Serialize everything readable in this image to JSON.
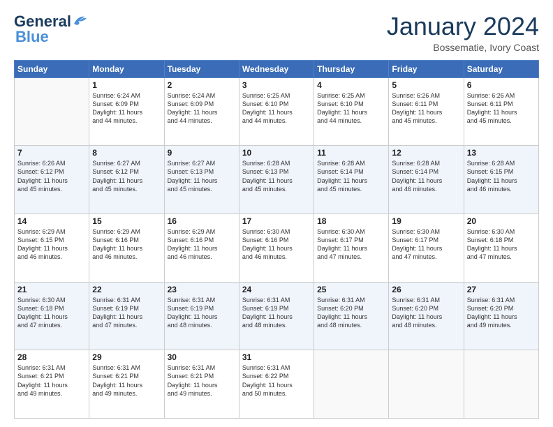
{
  "logo": {
    "line1": "General",
    "line2": "Blue"
  },
  "title": "January 2024",
  "subtitle": "Bossematie, Ivory Coast",
  "headers": [
    "Sunday",
    "Monday",
    "Tuesday",
    "Wednesday",
    "Thursday",
    "Friday",
    "Saturday"
  ],
  "weeks": [
    [
      {
        "day": "",
        "info": ""
      },
      {
        "day": "1",
        "info": "Sunrise: 6:24 AM\nSunset: 6:09 PM\nDaylight: 11 hours\nand 44 minutes."
      },
      {
        "day": "2",
        "info": "Sunrise: 6:24 AM\nSunset: 6:09 PM\nDaylight: 11 hours\nand 44 minutes."
      },
      {
        "day": "3",
        "info": "Sunrise: 6:25 AM\nSunset: 6:10 PM\nDaylight: 11 hours\nand 44 minutes."
      },
      {
        "day": "4",
        "info": "Sunrise: 6:25 AM\nSunset: 6:10 PM\nDaylight: 11 hours\nand 44 minutes."
      },
      {
        "day": "5",
        "info": "Sunrise: 6:26 AM\nSunset: 6:11 PM\nDaylight: 11 hours\nand 45 minutes."
      },
      {
        "day": "6",
        "info": "Sunrise: 6:26 AM\nSunset: 6:11 PM\nDaylight: 11 hours\nand 45 minutes."
      }
    ],
    [
      {
        "day": "7",
        "info": "Sunrise: 6:26 AM\nSunset: 6:12 PM\nDaylight: 11 hours\nand 45 minutes."
      },
      {
        "day": "8",
        "info": "Sunrise: 6:27 AM\nSunset: 6:12 PM\nDaylight: 11 hours\nand 45 minutes."
      },
      {
        "day": "9",
        "info": "Sunrise: 6:27 AM\nSunset: 6:13 PM\nDaylight: 11 hours\nand 45 minutes."
      },
      {
        "day": "10",
        "info": "Sunrise: 6:28 AM\nSunset: 6:13 PM\nDaylight: 11 hours\nand 45 minutes."
      },
      {
        "day": "11",
        "info": "Sunrise: 6:28 AM\nSunset: 6:14 PM\nDaylight: 11 hours\nand 45 minutes."
      },
      {
        "day": "12",
        "info": "Sunrise: 6:28 AM\nSunset: 6:14 PM\nDaylight: 11 hours\nand 46 minutes."
      },
      {
        "day": "13",
        "info": "Sunrise: 6:28 AM\nSunset: 6:15 PM\nDaylight: 11 hours\nand 46 minutes."
      }
    ],
    [
      {
        "day": "14",
        "info": "Sunrise: 6:29 AM\nSunset: 6:15 PM\nDaylight: 11 hours\nand 46 minutes."
      },
      {
        "day": "15",
        "info": "Sunrise: 6:29 AM\nSunset: 6:16 PM\nDaylight: 11 hours\nand 46 minutes."
      },
      {
        "day": "16",
        "info": "Sunrise: 6:29 AM\nSunset: 6:16 PM\nDaylight: 11 hours\nand 46 minutes."
      },
      {
        "day": "17",
        "info": "Sunrise: 6:30 AM\nSunset: 6:16 PM\nDaylight: 11 hours\nand 46 minutes."
      },
      {
        "day": "18",
        "info": "Sunrise: 6:30 AM\nSunset: 6:17 PM\nDaylight: 11 hours\nand 47 minutes."
      },
      {
        "day": "19",
        "info": "Sunrise: 6:30 AM\nSunset: 6:17 PM\nDaylight: 11 hours\nand 47 minutes."
      },
      {
        "day": "20",
        "info": "Sunrise: 6:30 AM\nSunset: 6:18 PM\nDaylight: 11 hours\nand 47 minutes."
      }
    ],
    [
      {
        "day": "21",
        "info": "Sunrise: 6:30 AM\nSunset: 6:18 PM\nDaylight: 11 hours\nand 47 minutes."
      },
      {
        "day": "22",
        "info": "Sunrise: 6:31 AM\nSunset: 6:19 PM\nDaylight: 11 hours\nand 47 minutes."
      },
      {
        "day": "23",
        "info": "Sunrise: 6:31 AM\nSunset: 6:19 PM\nDaylight: 11 hours\nand 48 minutes."
      },
      {
        "day": "24",
        "info": "Sunrise: 6:31 AM\nSunset: 6:19 PM\nDaylight: 11 hours\nand 48 minutes."
      },
      {
        "day": "25",
        "info": "Sunrise: 6:31 AM\nSunset: 6:20 PM\nDaylight: 11 hours\nand 48 minutes."
      },
      {
        "day": "26",
        "info": "Sunrise: 6:31 AM\nSunset: 6:20 PM\nDaylight: 11 hours\nand 48 minutes."
      },
      {
        "day": "27",
        "info": "Sunrise: 6:31 AM\nSunset: 6:20 PM\nDaylight: 11 hours\nand 49 minutes."
      }
    ],
    [
      {
        "day": "28",
        "info": "Sunrise: 6:31 AM\nSunset: 6:21 PM\nDaylight: 11 hours\nand 49 minutes."
      },
      {
        "day": "29",
        "info": "Sunrise: 6:31 AM\nSunset: 6:21 PM\nDaylight: 11 hours\nand 49 minutes."
      },
      {
        "day": "30",
        "info": "Sunrise: 6:31 AM\nSunset: 6:21 PM\nDaylight: 11 hours\nand 49 minutes."
      },
      {
        "day": "31",
        "info": "Sunrise: 6:31 AM\nSunset: 6:22 PM\nDaylight: 11 hours\nand 50 minutes."
      },
      {
        "day": "",
        "info": ""
      },
      {
        "day": "",
        "info": ""
      },
      {
        "day": "",
        "info": ""
      }
    ]
  ]
}
